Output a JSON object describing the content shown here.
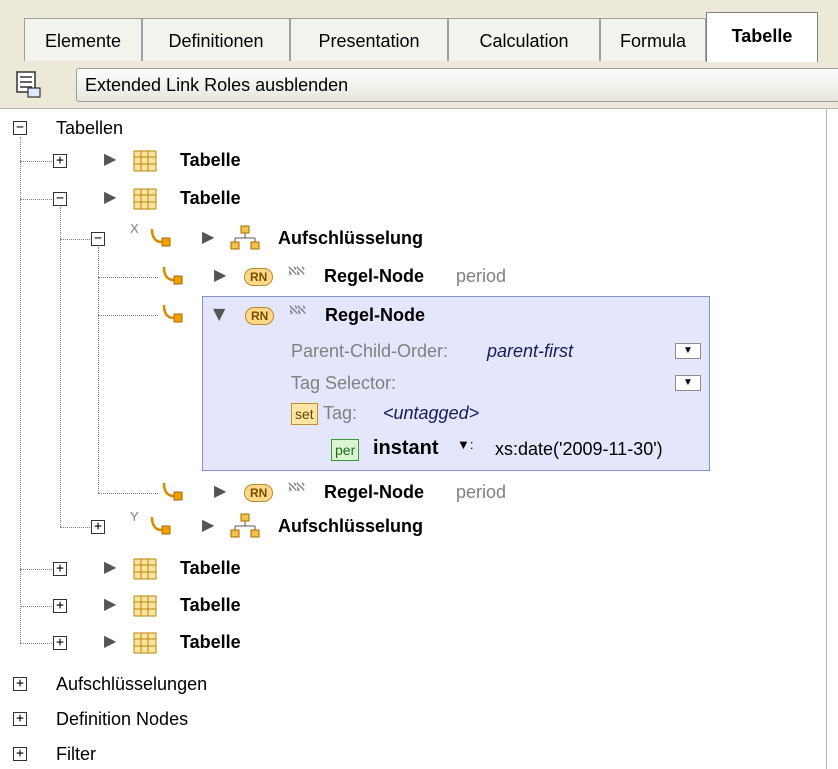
{
  "tabs": [
    {
      "label": "Elemente"
    },
    {
      "label": "Definitionen"
    },
    {
      "label": "Presentation"
    },
    {
      "label": "Calculation"
    },
    {
      "label": "Formula"
    },
    {
      "label": "Tabelle",
      "active": true
    }
  ],
  "toolbar": {
    "icon": "tree-view-icon",
    "button_label": "Extended Link Roles ausblenden"
  },
  "tree": {
    "root_label": "Tabellen",
    "table_label": "Tabelle",
    "breakdown_label": "Aufschlüsselung",
    "rule_node_label": "Regel-Node",
    "rn_badge": "RN",
    "period_suffix": "period",
    "axis_x": "X",
    "axis_y": "Y"
  },
  "popup": {
    "title": "Regel-Node",
    "parent_child_order_label": "Parent-Child-Order:",
    "parent_child_order_value": "parent-first",
    "tag_selector_label": "Tag Selector:",
    "set_badge": "set",
    "tag_label": "Tag:",
    "tag_value": "<untagged>",
    "per_badge": "per",
    "aspect_name": "instant",
    "aspect_value": "xs:date('2009-11-30')"
  },
  "bottom_items": [
    {
      "label": "Aufschlüsselungen"
    },
    {
      "label": "Definition Nodes"
    },
    {
      "label": "Filter"
    }
  ],
  "colors": {
    "popup_bg": "#e4e6fb",
    "popup_border": "#8a8fcf",
    "rn_badge_bg": "#ffd98a",
    "tab_bar_bg": "#ece9d8"
  }
}
